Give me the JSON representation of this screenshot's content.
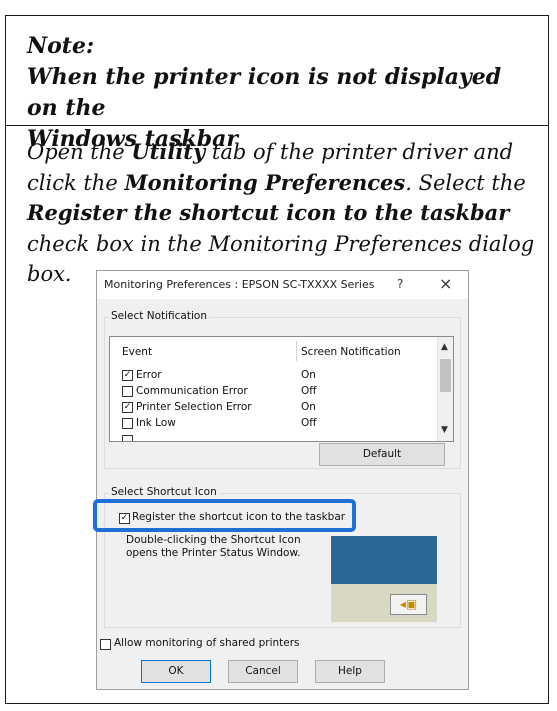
{
  "note": {
    "title_line1": "Note:",
    "title_line2": "When the printer icon is not displayed on the",
    "title_line3": "Windows taskbar",
    "body": {
      "t1": "Open the ",
      "b1": "Utility",
      "t2": " tab of the printer driver and click the ",
      "b2": "Monitoring Preferences",
      "t3": ". Select the ",
      "b3": "Register the shortcut icon to the taskbar",
      "t4": " check box in the Monitoring Preferences dialog box."
    }
  },
  "dialog": {
    "title": "Monitoring Preferences : EPSON SC-TXXXX Series",
    "help_glyph": "?",
    "close_glyph": "×",
    "select_notification": {
      "label": "Select Notification",
      "columns": [
        "Event",
        "Screen Notification"
      ],
      "rows": [
        {
          "event": "Error",
          "checked": true,
          "check_glyph": "✓",
          "value": "On"
        },
        {
          "event": "Communication Error",
          "checked": false,
          "check_glyph": "",
          "value": "Off"
        },
        {
          "event": "Printer Selection Error",
          "checked": true,
          "check_glyph": "✓",
          "value": "On"
        },
        {
          "event": "Ink Low",
          "checked": false,
          "check_glyph": "",
          "value": "Off"
        }
      ],
      "default_button": "Default"
    },
    "select_shortcut": {
      "label": "Select Shortcut Icon",
      "register_label": "Register the shortcut icon to the taskbar",
      "register_checked": true,
      "register_glyph": "✓",
      "description": "Double-clicking the Shortcut Icon opens the Printer Status Window."
    },
    "allow_shared_label": "Allow monitoring of shared printers",
    "allow_shared_checked": false,
    "buttons": {
      "ok": "OK",
      "cancel": "Cancel",
      "help": "Help"
    }
  },
  "colors": {
    "highlight": "#1f6fd6",
    "preview_bg": "#2d6795"
  },
  "icons": [
    "scroll-up-arrow-icon",
    "scroll-down-arrow-icon",
    "printer-tray-icon"
  ]
}
